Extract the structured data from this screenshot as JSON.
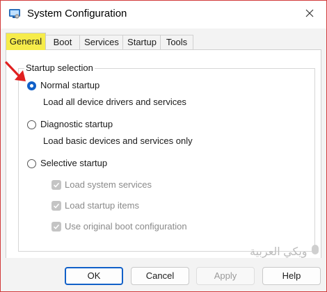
{
  "window": {
    "title": "System Configuration"
  },
  "tabs": [
    {
      "label": "General",
      "active": true
    },
    {
      "label": "Boot",
      "active": false
    },
    {
      "label": "Services",
      "active": false
    },
    {
      "label": "Startup",
      "active": false
    },
    {
      "label": "Tools",
      "active": false
    }
  ],
  "startup_selection": {
    "legend": "Startup selection",
    "options": [
      {
        "label": "Normal startup",
        "description": "Load all device drivers and services",
        "selected": true
      },
      {
        "label": "Diagnostic startup",
        "description": "Load basic devices and services only",
        "selected": false
      },
      {
        "label": "Selective startup",
        "selected": false
      }
    ],
    "selective_items": [
      {
        "label": "Load system services",
        "checked": true,
        "enabled": false
      },
      {
        "label": "Load startup items",
        "checked": true,
        "enabled": false
      },
      {
        "label": "Use original boot configuration",
        "checked": true,
        "enabled": false
      }
    ]
  },
  "buttons": {
    "ok": "OK",
    "cancel": "Cancel",
    "apply": "Apply",
    "help": "Help"
  },
  "watermark": "ويكي العربية",
  "colors": {
    "accent": "#1160c8",
    "tab_highlight": "#f6ec4a",
    "annotation_arrow": "#e02020",
    "window_border": "#d23a3a"
  }
}
